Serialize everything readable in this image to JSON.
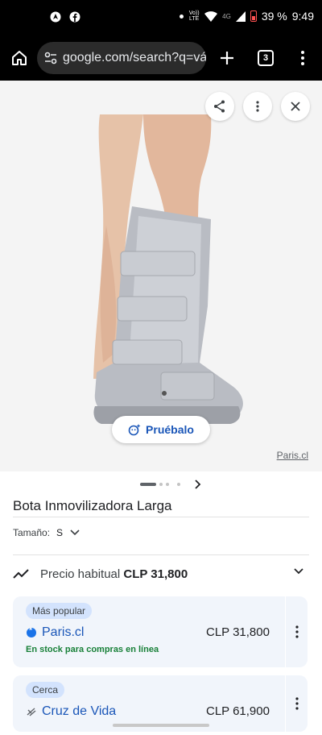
{
  "status_bar": {
    "volte_label": "Vo)) LTE",
    "network_label": "4G",
    "battery": "39 %",
    "time": "9:49",
    "icons": [
      "android-auto-icon",
      "facebook-icon",
      "dot-icon",
      "volte-icon",
      "wifi-icon",
      "signal-icon",
      "battery-icon"
    ]
  },
  "browser": {
    "url": "google.com/search?q=vá",
    "tab_count": "3",
    "icons": [
      "home-icon",
      "tune-icon",
      "plus-icon",
      "tabs-icon",
      "more-vert-icon"
    ]
  },
  "viewer": {
    "try_button_label": "Pruébalo",
    "source": "Paris.cl",
    "icons": [
      "share-icon",
      "more-vert-icon",
      "close-icon",
      "try-on-icon"
    ]
  },
  "pager": {
    "total": 4,
    "current": 1
  },
  "product": {
    "title": "Bota Inmovilizadora Larga",
    "size_label": "Tamaño:",
    "size_value": "S"
  },
  "price": {
    "label": "Precio habitual",
    "value": "CLP 31,800"
  },
  "offers": [
    {
      "badge": "Más popular",
      "store": "Paris.cl",
      "price": "CLP 31,800",
      "stock": "En stock para compras en línea",
      "icon": "paris-logo-icon"
    },
    {
      "badge": "Cerca",
      "store": "Cruz de Vida",
      "price": "CLP 61,900",
      "icon": "cruz-de-vida-logo-icon"
    }
  ],
  "colors": {
    "link_blue": "#1a56b8",
    "stock_green": "#188038",
    "card_bg": "#f1f5fb",
    "badge_bg": "#d3e3fd",
    "battery_red": "#ff5252"
  }
}
